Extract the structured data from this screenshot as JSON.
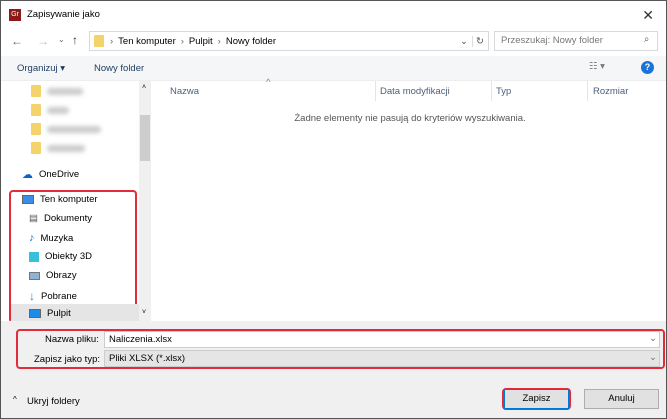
{
  "title": "Zapisywanie jako",
  "app_icon": "Gr",
  "breadcrumb": [
    "Ten komputer",
    "Pulpit",
    "Nowy folder"
  ],
  "search_placeholder": "Przeszukaj: Nowy folder",
  "toolbar": {
    "organize": "Organizuj ▾",
    "new_folder": "Nowy folder"
  },
  "nav": {
    "onedrive": "OneDrive",
    "computer": "Ten komputer",
    "items": [
      "Dokumenty",
      "Muzyka",
      "Obiekty 3D",
      "Obrazy",
      "Pobrane",
      "Pulpit"
    ]
  },
  "columns": [
    "Nazwa",
    "Data modyfikacji",
    "Typ",
    "Rozmiar"
  ],
  "empty_message": "Żadne elementy nie pasują do kryteriów wyszukiwania.",
  "form": {
    "filename_label": "Nazwa pliku:",
    "filename": "Naliczenia.xlsx",
    "type_label": "Zapisz jako typ:",
    "type": "Pliki XLSX (*.xlsx)"
  },
  "hide_folders": "Ukryj foldery",
  "buttons": {
    "save": "Zapisz",
    "cancel": "Anuluj"
  },
  "colors": {
    "highlight": "#e32b3a",
    "selected": "#e5e5e5"
  }
}
